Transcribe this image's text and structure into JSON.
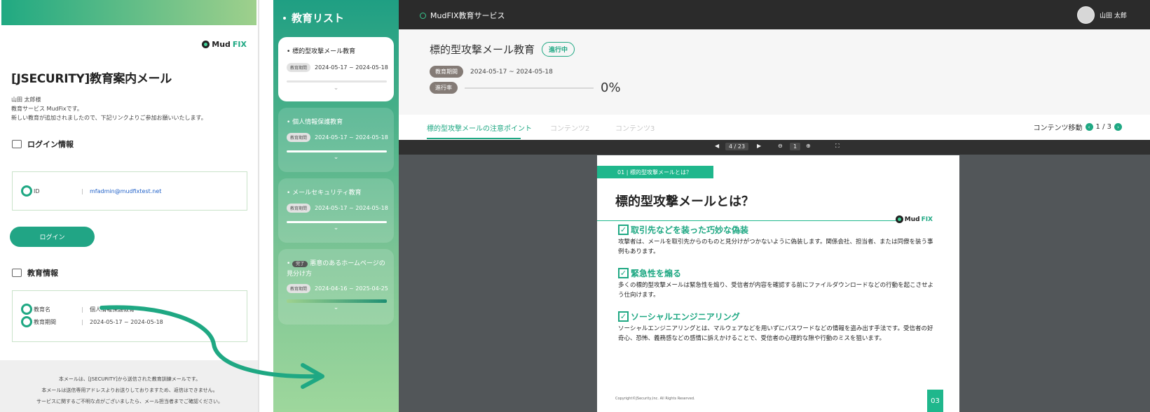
{
  "email": {
    "logo_a": "Mud",
    "logo_b": "FIX",
    "title": "[JSECURITY]教育案内メール",
    "greeting": [
      "山田 太郎様",
      "教育サービス MudFixです。",
      "新しい教育が追加されましたので、下記リンクよりご参加お願いいたします。"
    ],
    "login_section": "ログイン情報",
    "id_label": "ID",
    "id_value": "mfadmin@mudfixtest.net",
    "login_button": "ログイン",
    "edu_section": "教育情報",
    "course_label": "教育名",
    "course_value": "個人情報保護教育",
    "period_label": "教育期間",
    "period_value": "2024-05-17 ~ 2024-05-18",
    "separator": "|",
    "footer": [
      "本メールは、[JSECURITY]から送信された教育訓練メールです。",
      "本メールは送信専用アドレスよりお送りしておりますため、返信はできません。",
      "サービスに関するご不明な点がございましたら、メール担当者までご確認ください。"
    ]
  },
  "edu_list": {
    "title": "教育リスト",
    "period_pill": "教育期間",
    "done_label": "完了",
    "chevron": "⌄",
    "items": [
      {
        "title": "標的型攻撃メール教育",
        "period": "2024-05-17 ~ 2024-05-18"
      },
      {
        "title": "個人情報保護教育",
        "period": "2024-05-17 ~ 2024-05-18"
      },
      {
        "title": "メールセキュリティ教育",
        "period": "2024-05-17 ~ 2024-05-18"
      },
      {
        "title": "悪意のあるホームページの見分け方",
        "period": "2024-04-16 ~ 2025-04-25"
      }
    ]
  },
  "topbar": {
    "service": "MudFIX教育サービス",
    "user": "山田 太郎"
  },
  "course": {
    "title": "標的型攻撃メール教育",
    "status": "進行中",
    "period_label": "教育期間",
    "period": "2024-05-17 ~ 2024-05-18",
    "progress_label": "進行率",
    "progress_text": "0%",
    "progress": 0
  },
  "tabs": [
    "標的型攻撃メールの注意ポイント",
    "コンテンツ2",
    "コンテンツ3"
  ],
  "content_nav": {
    "label": "コンテンツ移動",
    "page": "1 / 3",
    "prev_icon": "‹",
    "next_icon": "›"
  },
  "pdf_toolbar": {
    "page": "4 / 23",
    "zoom": "1",
    "prev_icon": "◀",
    "next_icon": "▶",
    "zoom_out_icon": "⊖",
    "zoom_in_icon": "⊕",
    "fullscreen_icon": "⛶"
  },
  "slide": {
    "tag": "01 | 標的型攻撃メールとは？",
    "heading": "標的型攻撃メールとは？",
    "logo_a": "Mud",
    "logo_b": "FIX",
    "check": "✓",
    "points": [
      {
        "title": "取引先などを装った巧妙な偽装",
        "body": "攻撃者は、メールを取引先からのものと見分けがつかないように偽装します。関係会社、担当者、または同僚を装う事例もあります。"
      },
      {
        "title": "緊急性を煽る",
        "body": "多くの標的型攻撃メールは緊急性を煽り、受信者が内容を確認する前にファイルダウンロードなどの行動を起こさせよう仕向けます。"
      },
      {
        "title": "ソーシャルエンジニアリング",
        "body": "ソーシャルエンジニアリングとは、マルウェアなどを用いずにパスワードなどの情報を盗み出す手法です。受信者の好奇心、恐怖、義務感などの感情に訴えかけることで、受信者の心理的な隙や行動のミスを狙います。"
      }
    ],
    "copyright": "Copyright©JSecurity,Inc. All Rights Reserved.",
    "page_no": "03"
  },
  "colors": {
    "accent": "#1fa883",
    "topbar": "#2b2b2b",
    "viewer_bg": "#525659"
  }
}
